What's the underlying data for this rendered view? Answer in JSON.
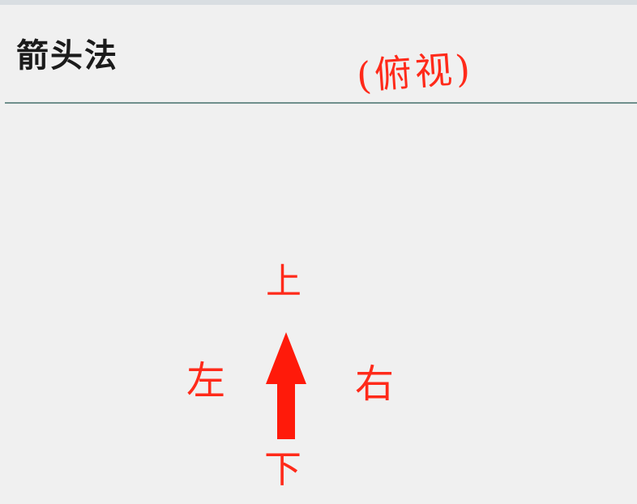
{
  "slide": {
    "title": "箭头法",
    "note": "(俯视)",
    "directions": {
      "up": "上",
      "down": "下",
      "left": "左",
      "right": "右"
    }
  },
  "colors": {
    "ink_red": "#ff2a1a",
    "title_text": "#1b1b1b",
    "rule": "#6f8f8c",
    "background": "#f0f0f0"
  },
  "icons": {
    "arrow": "up-arrow-icon"
  }
}
